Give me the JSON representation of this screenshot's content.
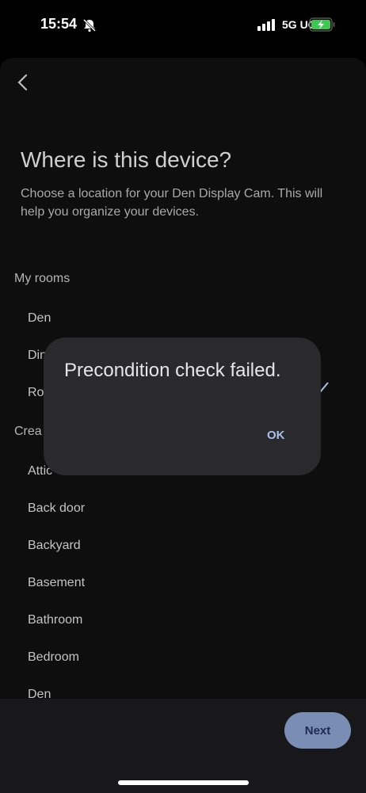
{
  "status_bar": {
    "time": "15:54",
    "network": "5G UC",
    "icons": [
      "bell-slash-icon",
      "signal-icon",
      "battery-charging-icon"
    ]
  },
  "header": {
    "back_icon": "chevron-left-icon"
  },
  "page": {
    "title": "Where is this device?",
    "subtitle": "Choose a location for your Den Display Cam. This will help you organize your devices."
  },
  "my_rooms": {
    "label": "My rooms",
    "items": [
      "Den",
      "Din",
      "Ro"
    ]
  },
  "create_section": {
    "label": "Crea",
    "items": [
      "Attic",
      "Back door",
      "Backyard",
      "Basement",
      "Bathroom",
      "Bedroom",
      "Den"
    ]
  },
  "footer": {
    "next_label": "Next"
  },
  "dialog": {
    "message": "Precondition check failed.",
    "ok_label": "OK"
  },
  "colors": {
    "accent": "#7a8db5",
    "dialog_bg": "#2a2a2c",
    "ok_text": "#a9c1ea"
  }
}
